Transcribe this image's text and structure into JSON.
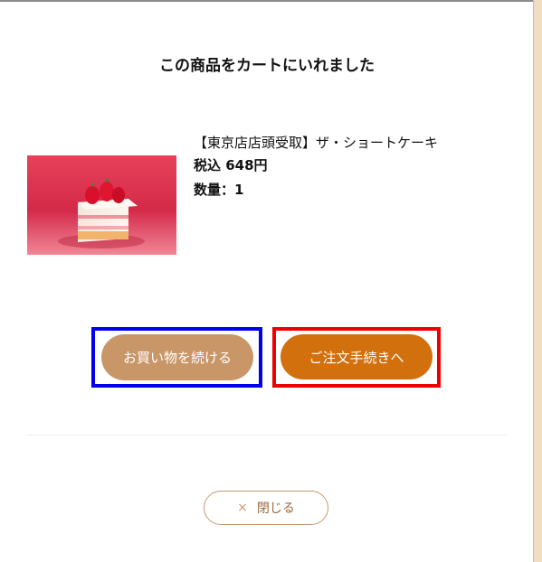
{
  "modal": {
    "title": "この商品をカートにいれました"
  },
  "product": {
    "name": "【東京店店頭受取】ザ・ショートケーキ",
    "price": "税込 648円",
    "quantity": "数量：1",
    "image_icon": "strawberry-shortcake-photo"
  },
  "actions": {
    "continue_shopping_label": "お買い物を続ける",
    "checkout_label": "ご注文手続きへ",
    "close_label": "閉じる",
    "close_icon": "close-icon"
  },
  "colors": {
    "continue_button": "#c99668",
    "checkout_button": "#d2700e",
    "close_border": "#c99a70",
    "highlight_blue": "#0000ee",
    "highlight_red": "#ee0000"
  }
}
